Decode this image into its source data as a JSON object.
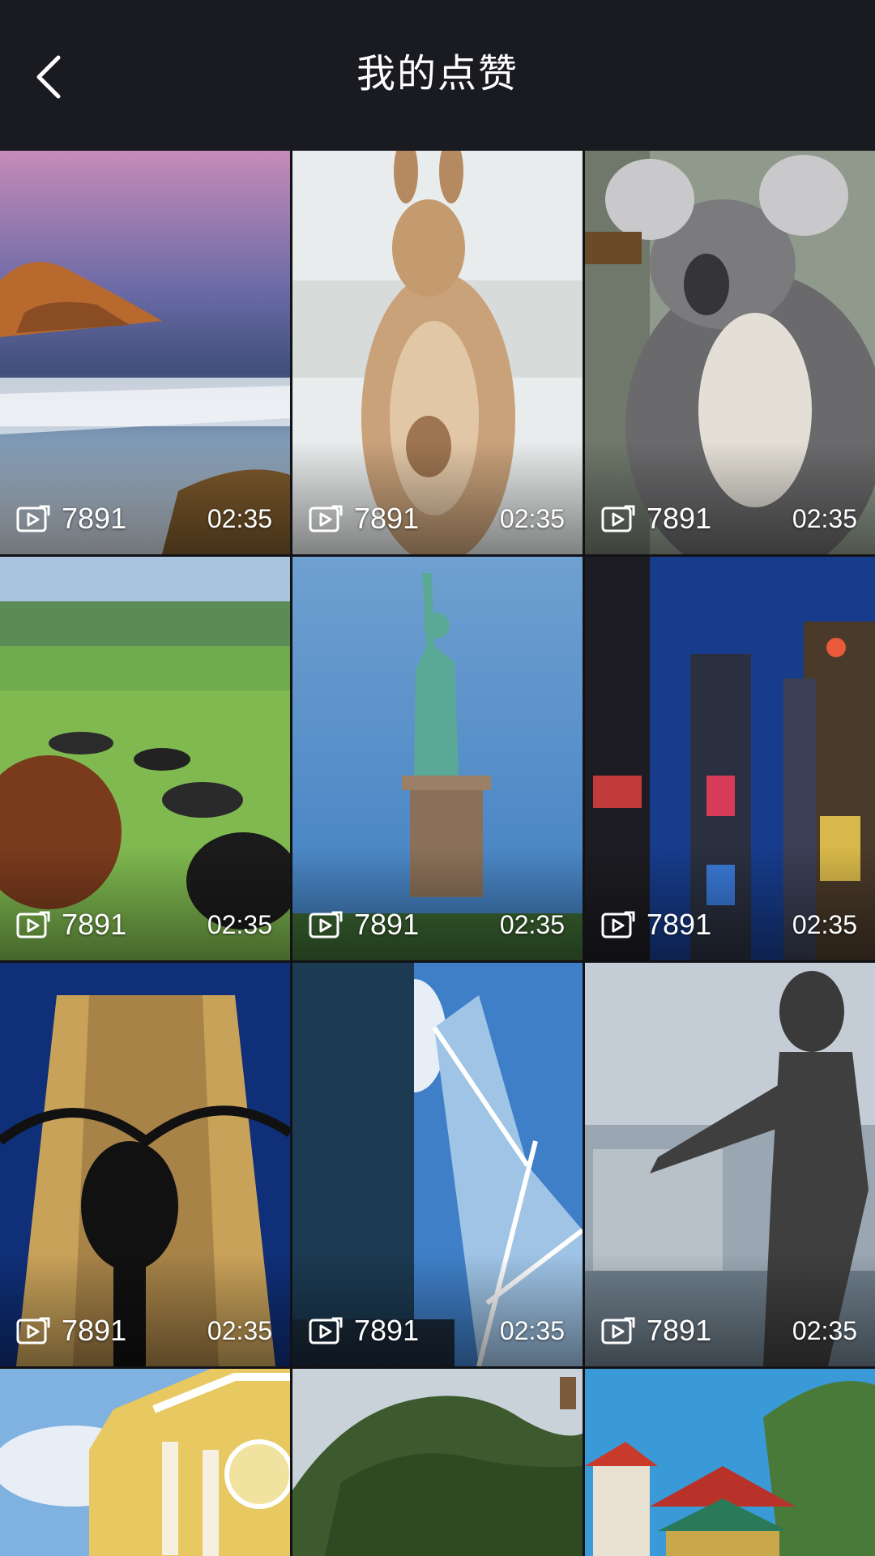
{
  "header": {
    "title": "我的点赞",
    "back_icon": "chevron-left-icon"
  },
  "grid": {
    "items": [
      {
        "name": "coast-waterfall",
        "plays": "7891",
        "duration": "02:35"
      },
      {
        "name": "kangaroo",
        "plays": "7891",
        "duration": "02:35"
      },
      {
        "name": "koala",
        "plays": "7891",
        "duration": "02:35"
      },
      {
        "name": "cows-field",
        "plays": "7891",
        "duration": "02:35"
      },
      {
        "name": "statue-of-liberty",
        "plays": "7891",
        "duration": "02:35"
      },
      {
        "name": "times-square",
        "plays": "7891",
        "duration": "02:35"
      },
      {
        "name": "empire-state-building",
        "plays": "7891",
        "duration": "02:35"
      },
      {
        "name": "bank-of-china-tower",
        "plays": "7891",
        "duration": "02:35"
      },
      {
        "name": "bruce-lee-statue",
        "plays": "7891",
        "duration": "02:35"
      },
      {
        "name": "yellow-church",
        "plays": "",
        "duration": ""
      },
      {
        "name": "green-hill",
        "plays": "",
        "duration": ""
      },
      {
        "name": "chinese-temple",
        "plays": "",
        "duration": ""
      }
    ]
  },
  "colors": {
    "header_bg": "#1a1b21",
    "text": "#ffffff"
  }
}
